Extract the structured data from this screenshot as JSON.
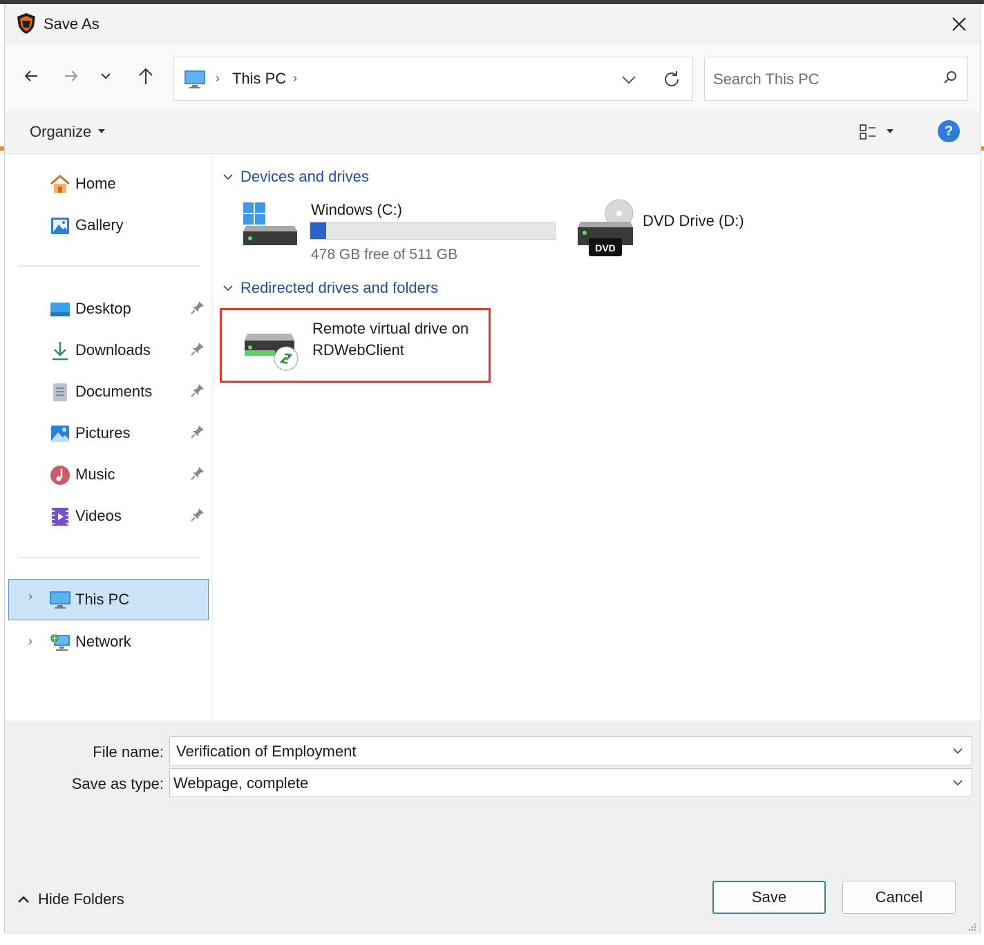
{
  "window": {
    "title": "Save As"
  },
  "nav": {
    "breadcrumb": [
      "This PC"
    ],
    "search_placeholder": "Search This PC"
  },
  "toolbar": {
    "organize_label": "Organize"
  },
  "sidebar": {
    "quick": [
      {
        "label": "Home",
        "icon": "home-icon"
      },
      {
        "label": "Gallery",
        "icon": "gallery-icon"
      }
    ],
    "pinned": [
      {
        "label": "Desktop",
        "icon": "desktop-icon"
      },
      {
        "label": "Downloads",
        "icon": "downloads-icon"
      },
      {
        "label": "Documents",
        "icon": "documents-icon"
      },
      {
        "label": "Pictures",
        "icon": "pictures-icon"
      },
      {
        "label": "Music",
        "icon": "music-icon"
      },
      {
        "label": "Videos",
        "icon": "videos-icon"
      }
    ],
    "tree": [
      {
        "label": "This PC",
        "icon": "this-pc-icon",
        "selected": true
      },
      {
        "label": "Network",
        "icon": "network-icon"
      }
    ]
  },
  "content": {
    "groups": [
      {
        "title": "Devices and drives"
      },
      {
        "title": "Redirected drives and folders"
      }
    ],
    "drives": [
      {
        "name": "Windows (C:)",
        "free_text": "478 GB free of 511 GB",
        "used_fraction": 0.065
      },
      {
        "name": "DVD Drive (D:)",
        "badge": "DVD"
      }
    ],
    "redirected": [
      {
        "name_line1": "Remote virtual drive on",
        "name_line2": "RDWebClient"
      }
    ]
  },
  "form": {
    "file_name_label": "File name:",
    "file_name_value": "Verification of Employment",
    "save_type_label": "Save as type:",
    "save_type_value": "Webpage, complete"
  },
  "footer": {
    "hide_folders_label": "Hide Folders",
    "save_label": "Save",
    "cancel_label": "Cancel"
  },
  "colors": {
    "accent": "#2f7cde",
    "highlight_box": "#e0392a",
    "selection": "#cce4f7"
  }
}
